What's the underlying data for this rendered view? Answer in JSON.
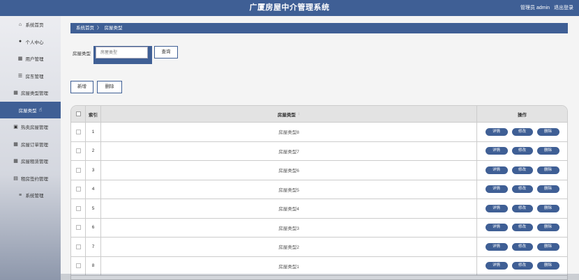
{
  "header": {
    "title": "广厦房屋中介管理系统",
    "user": "管理员 admin",
    "logout": "退出登录"
  },
  "sidebar": {
    "items": [
      {
        "label": "系统首页",
        "icon": "home-icon",
        "glyph": "⌂"
      },
      {
        "label": "个人中心",
        "icon": "user-icon",
        "glyph": "●"
      },
      {
        "label": "用户管理",
        "icon": "grid-icon",
        "glyph": "▦"
      },
      {
        "label": "房东管理",
        "icon": "sliders-icon",
        "glyph": "☰"
      },
      {
        "label": "房屋类型管理",
        "icon": "grid-icon",
        "glyph": "▦"
      },
      {
        "label": "房屋类型",
        "icon": "",
        "glyph": "",
        "active": true
      },
      {
        "label": "热卖房屋管理",
        "icon": "square-icon",
        "glyph": "▣"
      },
      {
        "label": "房屋订单管理",
        "icon": "grid-icon",
        "glyph": "▦"
      },
      {
        "label": "房屋租赁管理",
        "icon": "grid-icon",
        "glyph": "▦"
      },
      {
        "label": "租房签约管理",
        "icon": "doc-icon",
        "glyph": "▤"
      },
      {
        "label": "系统管理",
        "icon": "list-icon",
        "glyph": "≡"
      }
    ]
  },
  "breadcrumb": {
    "home": "系统首页",
    "sep": "〉",
    "current": "房屋类型"
  },
  "search": {
    "label": "房屋类型",
    "placeholder": "房屋类型",
    "button": "查询"
  },
  "actions": {
    "add": "新增",
    "delete": "删除"
  },
  "table": {
    "headers": {
      "index": "索引",
      "type": "房屋类型",
      "sort": "↕",
      "ops": "操作"
    },
    "op_labels": {
      "detail": "详情",
      "edit": "修改",
      "delete": "删除"
    },
    "rows": [
      {
        "index": "1",
        "type": "房屋类型8"
      },
      {
        "index": "2",
        "type": "房屋类型7"
      },
      {
        "index": "3",
        "type": "房屋类型6"
      },
      {
        "index": "4",
        "type": "房屋类型5"
      },
      {
        "index": "5",
        "type": "房屋类型4"
      },
      {
        "index": "6",
        "type": "房屋类型3"
      },
      {
        "index": "7",
        "type": "房屋类型2"
      },
      {
        "index": "8",
        "type": "房屋类型1"
      }
    ]
  },
  "colors": {
    "primary": "#3f5f95"
  }
}
